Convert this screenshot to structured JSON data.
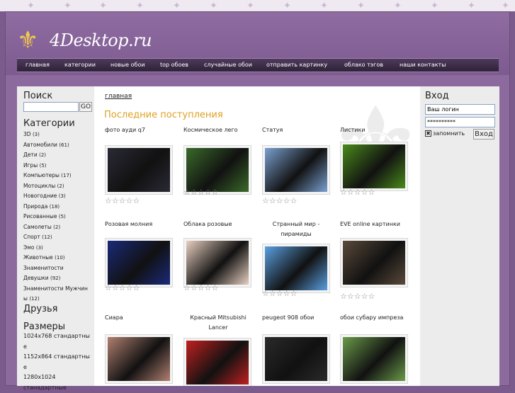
{
  "site": {
    "logo_text": "4Desktop.ru"
  },
  "nav": [
    "главная",
    "категории",
    "новые обои",
    "top обоев",
    "случайные обои",
    "отправить картинку",
    "облако тэгов",
    "наши контакты"
  ],
  "left": {
    "search_title": "Поиск",
    "search_value": "",
    "go_label": "GO",
    "categories_title": "Категории",
    "categories": [
      {
        "name": "3D",
        "count": "(3)"
      },
      {
        "name": "Автомобили",
        "count": "(61)"
      },
      {
        "name": "Дети",
        "count": "(2)"
      },
      {
        "name": "Игры",
        "count": "(5)"
      },
      {
        "name": "Компьютеры",
        "count": "(17)"
      },
      {
        "name": "Мотоциклы",
        "count": "(2)"
      },
      {
        "name": "Новогодние",
        "count": "(3)"
      },
      {
        "name": "Природа",
        "count": "(18)"
      },
      {
        "name": "Рисованные",
        "count": "(5)"
      },
      {
        "name": "Самолеты",
        "count": "(2)"
      },
      {
        "name": "Спорт",
        "count": "(12)"
      },
      {
        "name": "Эмо",
        "count": "(3)"
      },
      {
        "name": "Животные",
        "count": "(10)"
      },
      {
        "name": "Знаменитости",
        "count": ""
      },
      {
        "name": "Девушки",
        "count": "(92)"
      },
      {
        "name": "Знаменитости Мужчин",
        "count": ""
      },
      {
        "name": "ы",
        "count": "(12)"
      }
    ],
    "friends_title": "Друзья",
    "sizes_title": "Размеры",
    "sizes": [
      "1024x768 стандартны",
      "е",
      "1152x864 стандартны",
      "е",
      "1280x1024",
      "станадартные"
    ]
  },
  "main": {
    "breadcrumb": "главная",
    "section_title": "Последние поступления",
    "stars": "☆☆☆☆☆",
    "items": [
      {
        "title": "фото ауди q7",
        "color": "#2a2a35"
      },
      {
        "title": "Космическое лего",
        "color": "#3a6a2a"
      },
      {
        "title": "Статуя",
        "color": "#7aa0d0"
      },
      {
        "title": "Листики",
        "color": "#4a8a1a"
      },
      {
        "title": "Розовая молния",
        "color": "#1a2a7a"
      },
      {
        "title": "Облака розовые",
        "color": "#e8d0c0"
      },
      {
        "title": "Странный мир - пирамиды",
        "color": "#5aa0e0"
      },
      {
        "title": "EVE online картинки",
        "color": "#5a4a3a"
      },
      {
        "title": "Сиара",
        "color": "#b08070"
      },
      {
        "title": "Красный Mitsubishi Lancer",
        "color": "#c02020"
      },
      {
        "title": "peugeot 908 обои",
        "color": "#2a2a2a"
      },
      {
        "title": "обои субару импреза",
        "color": "#6a9a4a"
      }
    ]
  },
  "right": {
    "login_title": "Вход",
    "login_value": "Ваш логин",
    "password_value": "**********",
    "remember_label": "запомнить",
    "login_button": "Вход"
  }
}
